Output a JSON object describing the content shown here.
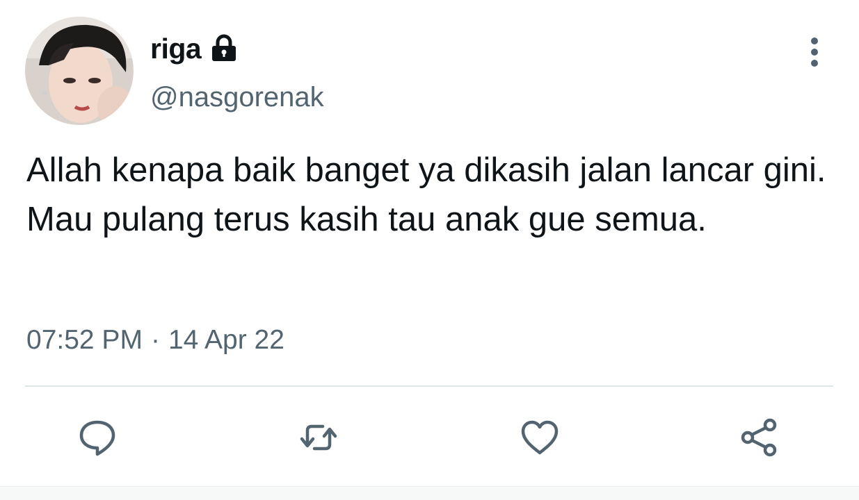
{
  "user": {
    "display_name": "riga",
    "handle": "@nasgorenak",
    "protected_icon": "lock-icon",
    "avatar": "avatar"
  },
  "tweet": {
    "text": "Allah kenapa baik banget ya dikasih jalan lancar gini. Mau pulang terus kasih tau anak gue semua.",
    "time": "07:52 PM",
    "separator": "·",
    "date": "14 Apr 22"
  },
  "menu": {
    "icon": "more-vertical-icon"
  },
  "actions": [
    {
      "name": "reply",
      "icon": "reply-icon"
    },
    {
      "name": "retweet",
      "icon": "retweet-icon"
    },
    {
      "name": "like",
      "icon": "heart-icon"
    },
    {
      "name": "share",
      "icon": "share-icon"
    }
  ],
  "colors": {
    "text": "#0f1419",
    "secondary": "#536471",
    "divider": "#dfe4e7"
  }
}
